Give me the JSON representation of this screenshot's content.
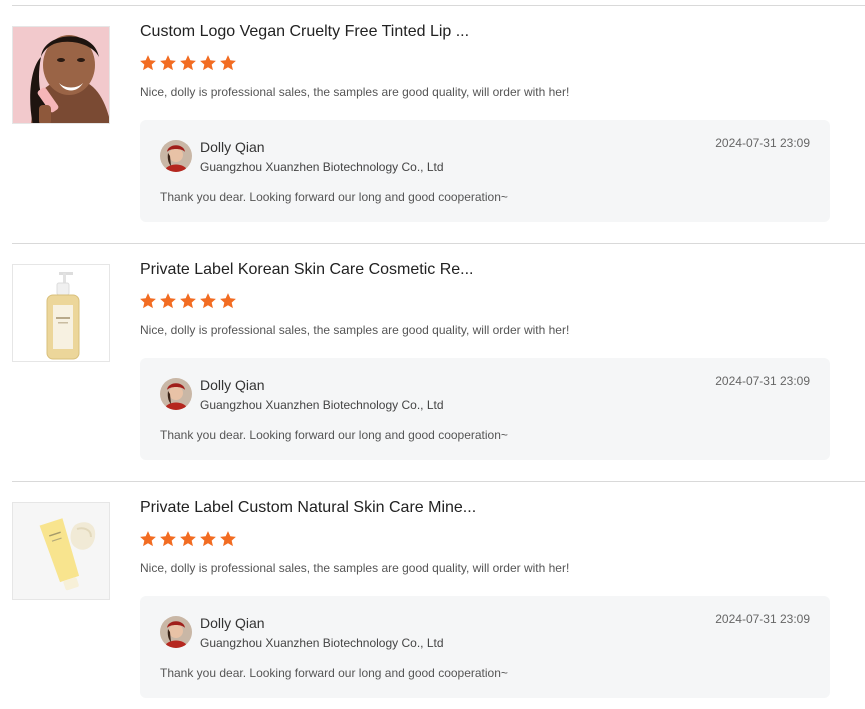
{
  "reviews": [
    {
      "product_image": "woman-with-lip-balm-image",
      "product_title": "Custom Logo Vegan Cruelty Free Tinted Lip ...",
      "rating": 5,
      "comment": "Nice, dolly is professional sales, the samples are good quality, will order with her!",
      "reply": {
        "name": "Dolly Qian",
        "company": "Guangzhou Xuanzhen Biotechnology Co., Ltd",
        "time": "2024-07-31 23:09",
        "text": "Thank you dear. Looking forward our long and good cooperation~"
      }
    },
    {
      "product_image": "cleansing-oil-pump-bottle-image",
      "product_title": "Private Label Korean Skin Care Cosmetic Re...",
      "rating": 5,
      "comment": "Nice, dolly is professional sales, the samples are good quality, will order with her!",
      "reply": {
        "name": "Dolly Qian",
        "company": "Guangzhou Xuanzhen Biotechnology Co., Ltd",
        "time": "2024-07-31 23:09",
        "text": "Thank you dear. Looking forward our long and good cooperation~"
      }
    },
    {
      "product_image": "sunscreen-tube-image",
      "product_title": "Private Label Custom Natural Skin Care Mine...",
      "rating": 5,
      "comment": "Nice, dolly is professional sales, the samples are good quality, will order with her!",
      "reply": {
        "name": "Dolly Qian",
        "company": "Guangzhou Xuanzhen Biotechnology Co., Ltd",
        "time": "2024-07-31 23:09",
        "text": "Thank you dear. Looking forward our long and good cooperation~"
      }
    }
  ],
  "colors": {
    "star": "#f26c22",
    "reply_background": "#f5f6f7",
    "divider": "#d9d9d9"
  }
}
